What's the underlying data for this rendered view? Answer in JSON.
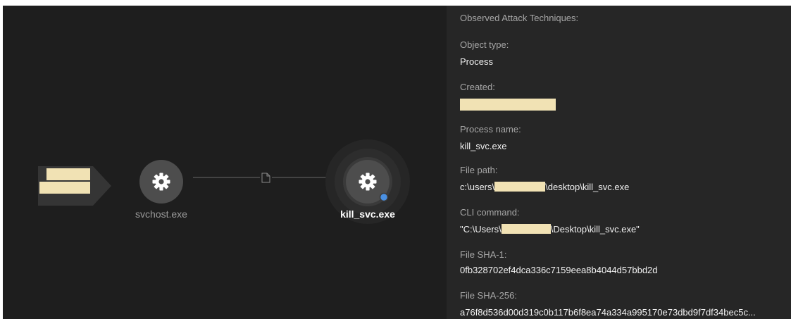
{
  "graph": {
    "nodes": [
      {
        "id": "svchost",
        "label": "svchost.exe",
        "icon": "gear-icon",
        "selected": false
      },
      {
        "id": "kill_svc",
        "label": "kill_svc.exe",
        "icon": "gear-icon",
        "selected": true
      }
    ],
    "edge_icon": "file-icon",
    "colors": {
      "background": "#1e1e1e",
      "node_fill": "#4d4d4d",
      "node_icon": "#ffffff",
      "edge": "#5a5a5a",
      "status_dot": "#4a90e2",
      "redaction": "#f1e2b4"
    }
  },
  "details": {
    "attack_techniques_label": "Observed Attack Techniques:",
    "object_type_label": "Object type:",
    "object_type_value": "Process",
    "created_label": "Created:",
    "process_name_label": "Process name:",
    "process_name_value": "kill_svc.exe",
    "file_path_label": "File path:",
    "file_path_prefix": "c:\\users\\",
    "file_path_suffix": "\\desktop\\kill_svc.exe",
    "cli_label": "CLI command:",
    "cli_prefix": "\"C:\\Users\\",
    "cli_suffix": "\\Desktop\\kill_svc.exe\"",
    "sha1_label": "File SHA-1:",
    "sha1_value": "0fb328702ef4dca336c7159eea8b4044d57bbd2d",
    "sha256_label": "File SHA-256:",
    "sha256_value": "a76f8d536d00d319c0b117b6f8ea74a334a995170e73dbd9f7df34bec5c..."
  }
}
